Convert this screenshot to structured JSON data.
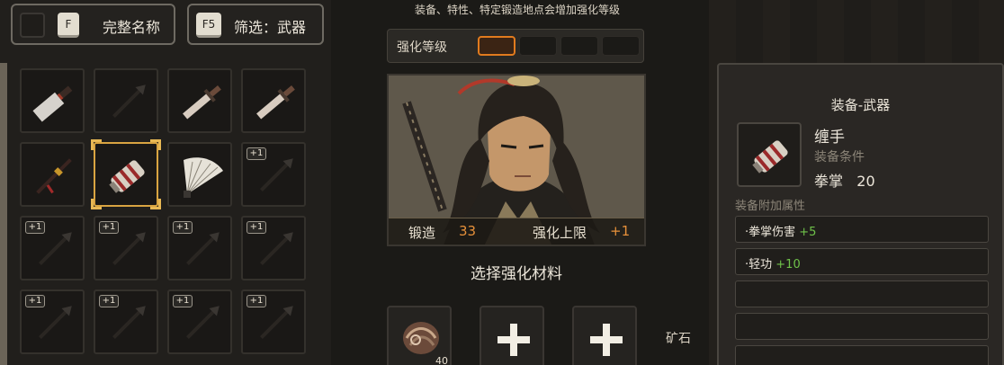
{
  "filters": {
    "fullname_key": "F",
    "fullname_label": "完整名称",
    "filter_key": "F5",
    "filter_label": "筛选：武器"
  },
  "inventory": {
    "slots": [
      {
        "icon": "cleaver-icon",
        "badge": ""
      },
      {
        "icon": "spear-icon",
        "badge": ""
      },
      {
        "icon": "dagger-icon",
        "badge": ""
      },
      {
        "icon": "dagger-icon",
        "badge": ""
      },
      {
        "icon": "staff-icon",
        "badge": ""
      },
      {
        "icon": "hand-wrap-icon",
        "badge": "",
        "selected": true
      },
      {
        "icon": "fan-icon",
        "badge": ""
      },
      {
        "icon": "spear-icon",
        "badge": "+1"
      },
      {
        "icon": "spear-icon",
        "badge": "+1"
      },
      {
        "icon": "spear-icon",
        "badge": "+1"
      },
      {
        "icon": "spear-icon",
        "badge": "+1"
      },
      {
        "icon": "spear-icon",
        "badge": "+1"
      },
      {
        "icon": "spear-icon",
        "badge": "+1"
      },
      {
        "icon": "spear-icon",
        "badge": "+1"
      },
      {
        "icon": "spear-icon",
        "badge": "+1"
      },
      {
        "icon": "spear-icon",
        "badge": "+1"
      }
    ]
  },
  "forge": {
    "hint": "装备、特性、特定锻造地点会增加强化等级",
    "level_label": "强化等级",
    "level_total": 4,
    "level_active": 1,
    "forging_label": "锻造",
    "forging_value": "33",
    "cap_label": "强化上限",
    "cap_value": "+1",
    "select_title": "选择强化材料",
    "material_count": "40",
    "ore_label": "矿石"
  },
  "item": {
    "category": "装备-武器",
    "name": "缠手",
    "condition_label": "装备条件",
    "req_name": "拳掌",
    "req_value": "20",
    "attr_title": "装备附加属性",
    "attrs": [
      {
        "name": "·拳掌伤害",
        "value": "+5"
      },
      {
        "name": "·轻功",
        "value": "+10"
      }
    ]
  },
  "colors": {
    "accent": "#e17b1e",
    "positive": "#6fc24a",
    "selected": "#d9a441"
  }
}
